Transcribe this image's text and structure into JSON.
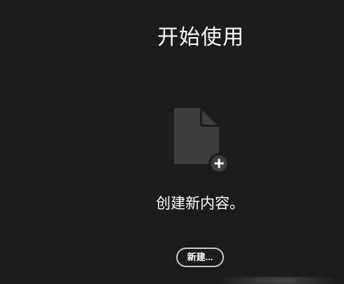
{
  "header": {
    "title": "开始使用"
  },
  "empty_state": {
    "icon": "new-document-icon",
    "message": "创建新内容。",
    "new_button_label": "新建..."
  },
  "colors": {
    "background": "#1b1b1b",
    "icon_fill": "#3d3d3d",
    "text": "#ffffff",
    "button_border": "#c9c9c9"
  }
}
